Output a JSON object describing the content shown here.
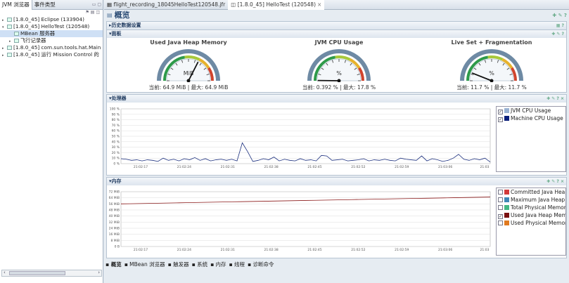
{
  "left_panel": {
    "tabs": [
      "JVM 浏览器",
      "事件类型"
    ],
    "tree": [
      {
        "label": "[1.8.0_45] Eclipse (133904)",
        "level": 0,
        "expander": "▸"
      },
      {
        "label": "[1.8.0_45] HelloTest (120548)",
        "level": 0,
        "expander": "▾"
      },
      {
        "label": "MBean 服务器",
        "level": 1,
        "expander": "",
        "selected": true
      },
      {
        "label": "飞行记录器",
        "level": 1,
        "expander": "▸"
      },
      {
        "label": "[1.8.0_45] com.sun.tools.hat.Main",
        "level": 0,
        "expander": "▸"
      },
      {
        "label": "[1.8.0_45] 运行 Mission Control 的",
        "level": 0,
        "expander": "▸"
      }
    ]
  },
  "editor_tabs": [
    {
      "label": "flight_recording_18045HelloTest120548.jfr",
      "active": false
    },
    {
      "label": "[1.8.0_45] HelloTest (120548)",
      "active": true
    }
  ],
  "page_title": "概览",
  "sections": {
    "history": "历史数据设置",
    "dashboard": "面板",
    "processor": "处理器",
    "memory": "内存"
  },
  "gauges": [
    {
      "title": "Used Java Heap Memory",
      "unit": "MiB",
      "value_fraction": 0.65,
      "caption": "当前: 64.9 MiB | 最大: 64.9 MiB"
    },
    {
      "title": "JVM CPU Usage",
      "unit": "%",
      "value_fraction": 0.004,
      "caption": "当前: 0.392 % | 最大: 17.8 %"
    },
    {
      "title": "Live Set + Fragmentation",
      "unit": "%",
      "value_fraction": 0.12,
      "caption": "当前: 11.7 % | 最大: 11.7 %"
    }
  ],
  "cpu_chart": {
    "y_ticks": [
      "100 %",
      "90 %",
      "80 %",
      "70 %",
      "60 %",
      "50 %",
      "40 %",
      "30 %",
      "20 %",
      "10 %",
      "0 %"
    ],
    "x_ticks": [
      "21:02:17",
      "21:02:24",
      "21:02:31",
      "21:02:38",
      "21:02:45",
      "21:02:52",
      "21:02:59",
      "21:03:06",
      "21:03"
    ],
    "legend": [
      {
        "label": "JVM CPU Usage",
        "color": "#9ab3d3",
        "checked": true
      },
      {
        "label": "Machine CPU Usage",
        "color": "#0a1f7a",
        "checked": true
      }
    ]
  },
  "memory_chart": {
    "y_ticks": [
      "72 MiB",
      "64 MiB",
      "56 MiB",
      "48 MiB",
      "40 MiB",
      "32 MiB",
      "24 MiB",
      "16 MiB",
      "8 MiB",
      "0 B"
    ],
    "x_ticks": [
      "21:02:17",
      "21:02:24",
      "21:02:31",
      "21:02:38",
      "21:02:45",
      "21:02:52",
      "21:02:59",
      "21:03:06",
      "21:03"
    ],
    "legend": [
      {
        "label": "Committed Java Heap",
        "color": "#d23a3a",
        "checked": false
      },
      {
        "label": "Maximum Java Heap",
        "color": "#3f88b6",
        "checked": false
      },
      {
        "label": "Total Physical Memory",
        "color": "#44b884",
        "checked": false
      },
      {
        "label": "Used Java Heap Memo",
        "color": "#7a1010",
        "checked": true
      },
      {
        "label": "Used Physical Memory",
        "color": "#e07a20",
        "checked": false
      }
    ]
  },
  "bottom_tabs": [
    "概览",
    "MBean 浏览器",
    "触发器",
    "系统",
    "内存",
    "线程",
    "诊断命令"
  ]
}
